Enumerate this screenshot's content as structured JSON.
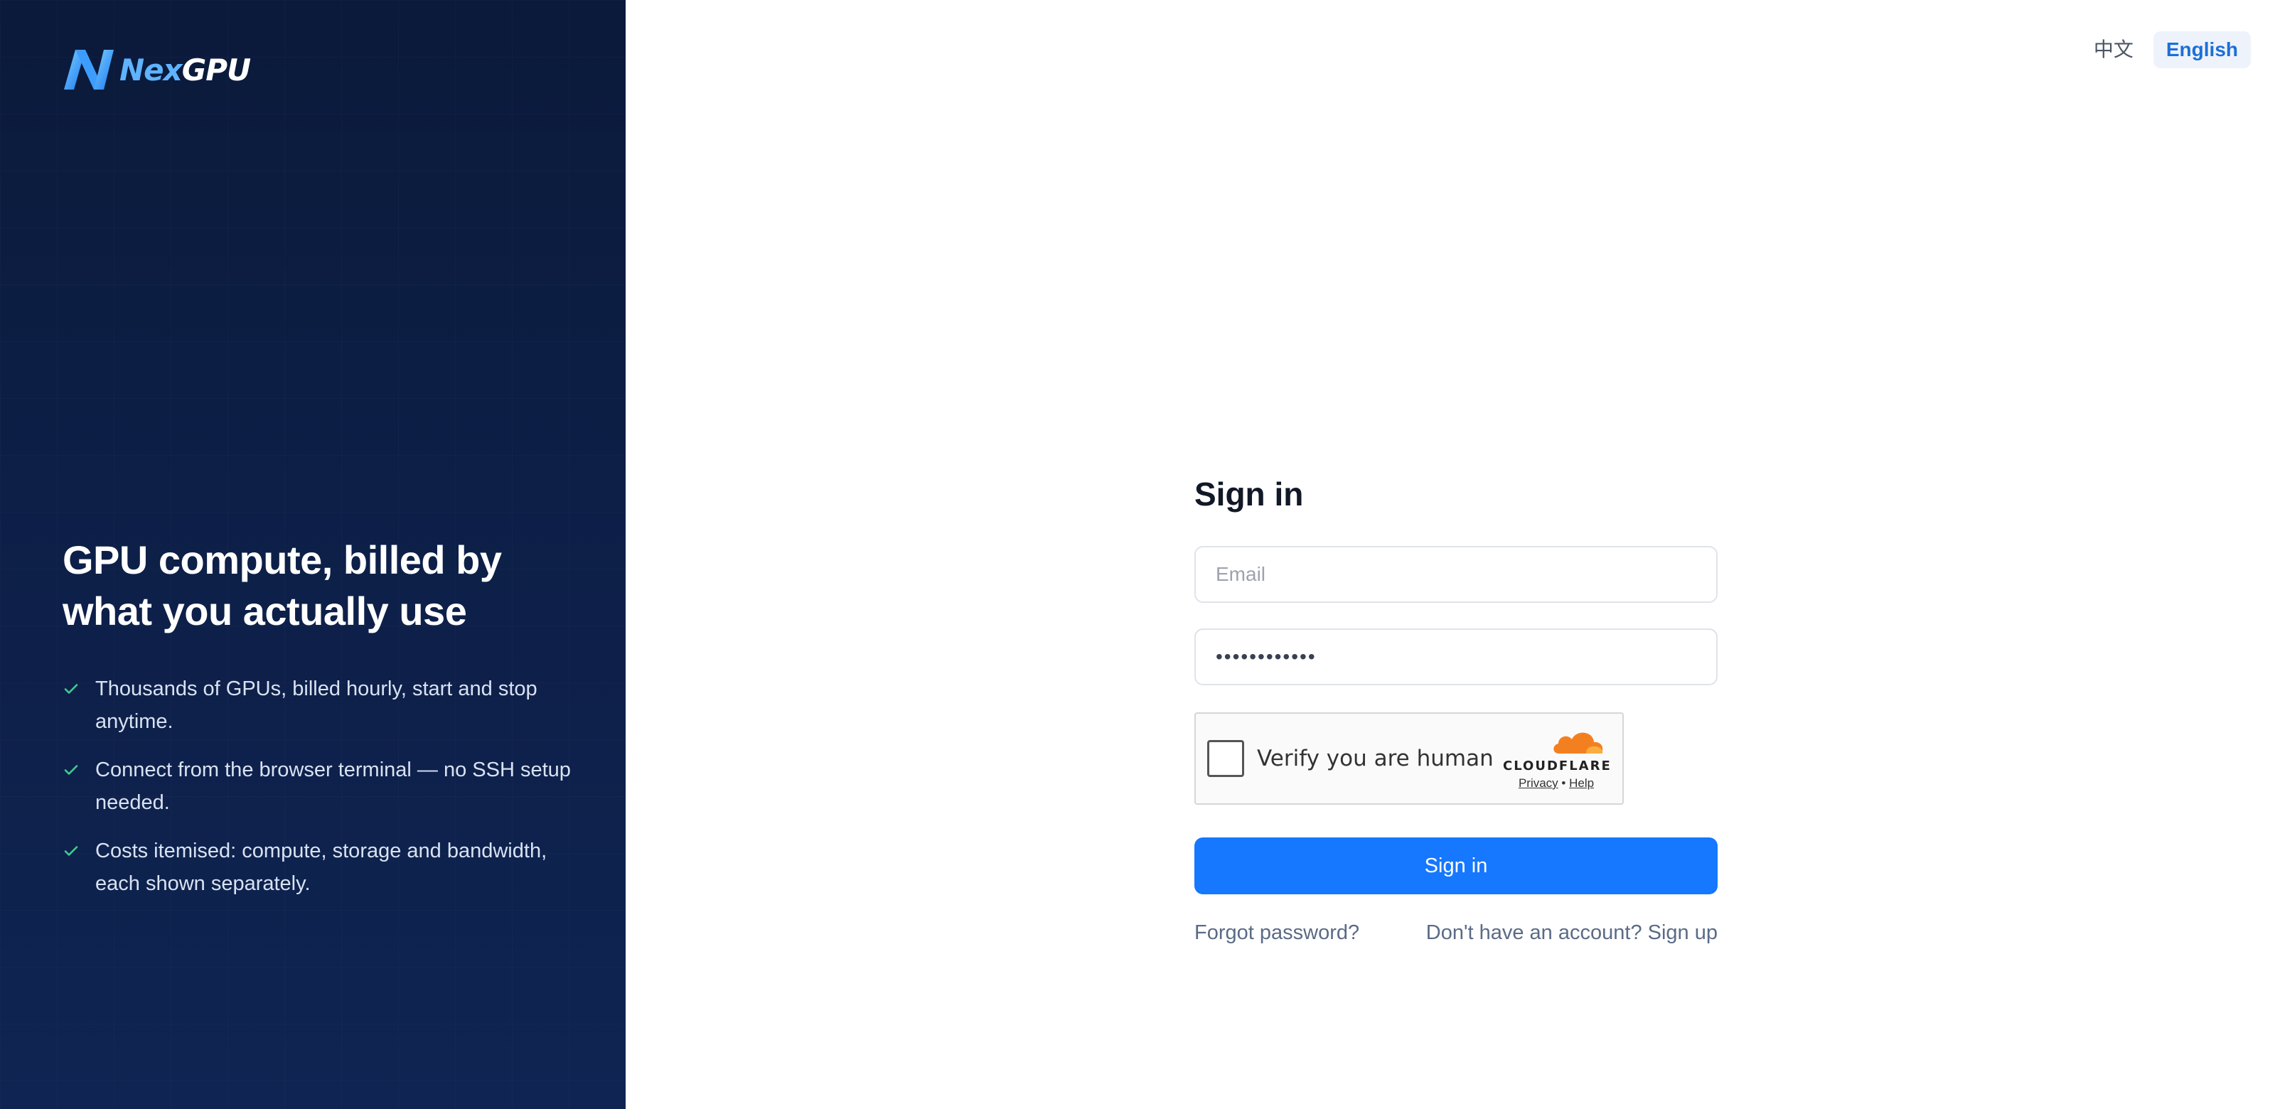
{
  "brand": {
    "name": "NexGPU",
    "name_part1": "Nex",
    "name_part2": "GPU"
  },
  "hero": {
    "title": "GPU compute, billed by what you actually use",
    "features": [
      "Thousands of GPUs, billed hourly, start and stop anytime.",
      "Connect from the browser terminal — no SSH setup needed.",
      "Costs itemised: compute, storage and bandwidth, each shown separately."
    ]
  },
  "language": {
    "options": [
      "中文",
      "English"
    ],
    "selected": "English"
  },
  "signin": {
    "title": "Sign in",
    "email": {
      "placeholder": "Email",
      "value": ""
    },
    "password": {
      "value": "••••••••••••"
    },
    "captcha": {
      "label": "Verify you are human",
      "brand": "CLOUDFLARE",
      "privacy": "Privacy",
      "separator": "•",
      "help": "Help"
    },
    "submit_label": "Sign in",
    "forgot_label": "Forgot password?",
    "signup_label": "Don't have an account? Sign up"
  },
  "colors": {
    "hero_bg": "#0d1f47",
    "accent": "#1677ff",
    "check": "#3ecf8e",
    "cloudflare": "#f38020"
  },
  "icons": {
    "logo": "nexgpu-logo-icon",
    "check": "check-icon",
    "cloud": "cloudflare-cloud-icon"
  }
}
